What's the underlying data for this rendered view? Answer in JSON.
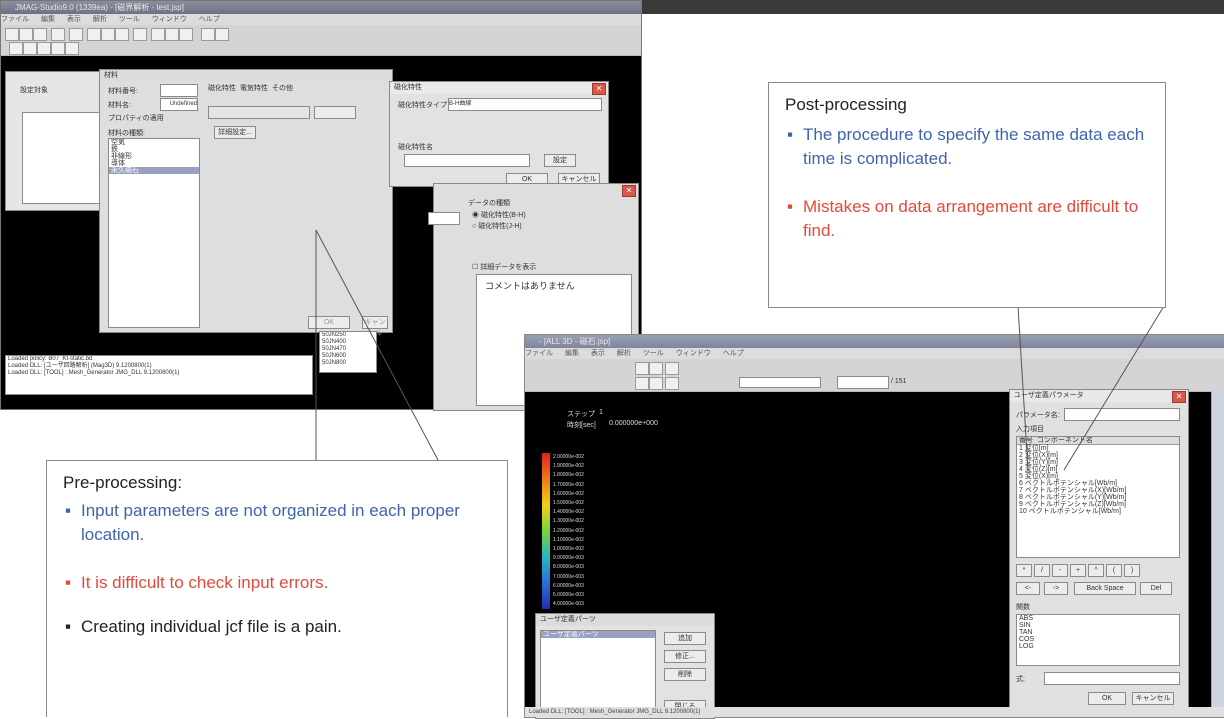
{
  "colors": {
    "blue_text": "#3f64ad",
    "red_text": "#e24a3c",
    "dark_text": "#222222",
    "callout_border": "#8a8a8a",
    "viewport_black": "#000000",
    "close_button": "#d8584a"
  },
  "pre_window": {
    "title": "JMAG-Studio9.0 (1339ea) - [磁界解析 - test.jsp]",
    "menu": [
      "ファイル",
      "編集",
      "表示",
      "解析",
      "ツール",
      "ウィンドウ",
      "ヘルプ"
    ],
    "material_panel": {
      "title": "材料",
      "label_number": "材料番号:",
      "label_name": "材料名:",
      "name_value": "Undefined",
      "label_profile": "プロパティの適用",
      "label_kind": "材料の種類:",
      "kinds": [
        "空気",
        "鉄",
        "非線形",
        "導体",
        "永久磁石"
      ],
      "tabs": [
        "磁化特性",
        "電気特性",
        "その他"
      ],
      "detail_button": "詳細設定...",
      "ok_button": "OK",
      "cancel_button": "キャンセル"
    },
    "magnet_dialog": {
      "title": "磁化特性",
      "label_type": "磁化特性タイプ",
      "type_value": "B-H曲線",
      "label_list": "磁化特性名",
      "set_button": "設定",
      "ok_button": "OK",
      "cancel_button": "キャンセル"
    },
    "data_dialog": {
      "label_kind": "データの種類",
      "radio1": "磁化特性(B-H)",
      "radio2": "磁化特性(J-H)",
      "checkbox": "詳細データを表示",
      "comment": "コメントはありません"
    },
    "list_values": [
      "50JN250",
      "50JN400",
      "50JN470",
      "50JN600",
      "50JN800"
    ],
    "log_lines": [
      "Loaded policy: B07_Kt-static.bd",
      "Loaded DLL: [ユーザ回路解析] (Mag3D) 9.1200800(1)",
      "Loaded DLL: [TOOL] : Mesh_Generator JMG_DLL 9.1200800(1)"
    ]
  },
  "post_window": {
    "title": "- [ALL 3D - 磁石.jsp]",
    "step_label": "ステップ",
    "step_value": "1",
    "time_label": "時刻[sec]",
    "time_value": "0.000000e+000",
    "frame_total": "/ 151",
    "legend_values": [
      "2.00000e-002",
      "1.90000e-002",
      "1.80000e-002",
      "1.70000e-002",
      "1.60000e-002",
      "1.50000e-002",
      "1.40000e-002",
      "1.30000e-002",
      "1.20000e-002",
      "1.10000e-002",
      "1.00000e-002",
      "9.00000e-003",
      "8.00000e-003",
      "7.00000e-003",
      "6.00000e-003",
      "5.00000e-003",
      "4.00000e-003"
    ],
    "user_dialog": {
      "title": "ユーザ定義パーツ",
      "list_title": "ユーザ定義パーツ",
      "buttons": [
        "追加",
        "修正...",
        "削除",
        "閉じる"
      ]
    },
    "calc_dialog": {
      "title": "ユーザ定義パラメータ",
      "label_name": "パラメータ名:",
      "label_input": "入力項目",
      "table_header": [
        "番号",
        "コンポーネント名"
      ],
      "rows": [
        "1  変位[m]",
        "2  変位(X)[m]",
        "3  変位(Y)[m]",
        "4  変位(Z)[m]",
        "5  変位(X)[m]",
        "6  ベクトルポテンシャル[Wb/m]",
        "7  ベクトルポテンシャル(X)[Wb/m]",
        "8  ベクトルポテンシャル(Y)[Wb/m]",
        "9  ベクトルポテンシャル(Z)[Wb/m]",
        "10 ベクトルポテンシャル[Wb/m]"
      ],
      "ops": [
        "*",
        "/",
        "-",
        "+",
        "^",
        "(",
        ")"
      ],
      "nav": [
        "<-",
        "->",
        "Back Space",
        "Del"
      ],
      "label_func": "関数",
      "functions": [
        "ABS",
        "SIN",
        "TAN",
        "COS",
        "LOG"
      ],
      "label_expr": "式:",
      "ok_button": "OK",
      "cancel_button": "キャンセル"
    },
    "status": "Loaded DLL: [TOOL] : Mesh_Generator JMG_DLL 9.1200800(1)"
  },
  "callout_post": {
    "heading": "Post-processing",
    "items": [
      {
        "text": "The procedure to specify the same data each time is complicated.",
        "color": "blue"
      },
      {
        "text": "Mistakes on data arrangement are difficult to find.",
        "color": "red"
      }
    ]
  },
  "callout_pre": {
    "heading": "Pre-processing:",
    "items": [
      {
        "text": "Input parameters are not organized in each proper location.",
        "color": "blue"
      },
      {
        "text": "It is difficult to check input errors.",
        "color": "red"
      },
      {
        "text": "Creating individual jcf file is a pain.",
        "color": "dark"
      }
    ]
  }
}
